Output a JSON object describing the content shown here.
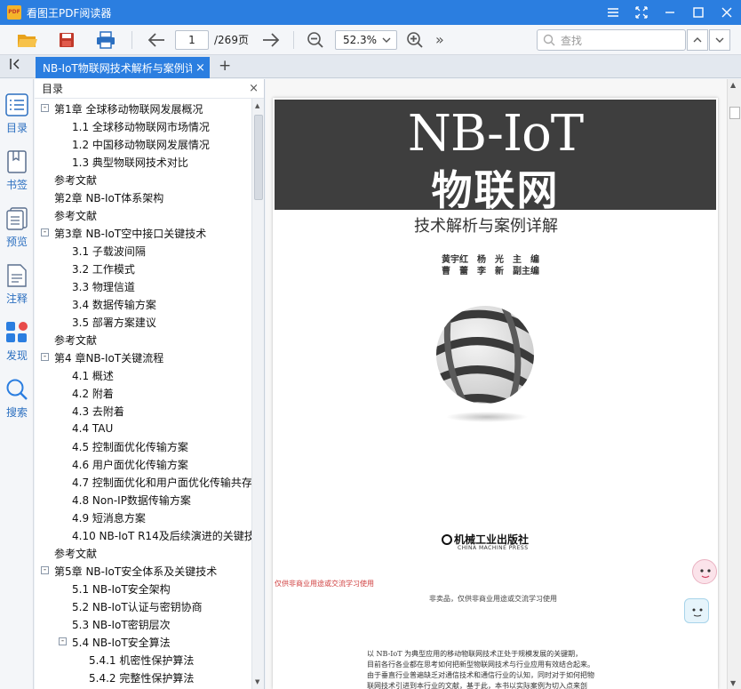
{
  "app": {
    "title": "看图王PDF阅读器",
    "logo_text": "PDF"
  },
  "toolbar": {
    "page_current": "1",
    "page_total": "/269页",
    "zoom": "52.3%",
    "search_placeholder": "查找",
    "more": "»"
  },
  "tab": {
    "label": "NB-IoT物联网技术解析与案例详解",
    "close": "×",
    "add": "+"
  },
  "leftbar": {
    "items": [
      {
        "label": "目录",
        "icon": "toc-icon"
      },
      {
        "label": "书签",
        "icon": "bookmark-icon"
      },
      {
        "label": "预览",
        "icon": "thumbnail-icon"
      },
      {
        "label": "注释",
        "icon": "annotation-icon"
      },
      {
        "label": "发现",
        "icon": "discover-icon"
      },
      {
        "label": "搜索",
        "icon": "search-icon"
      }
    ]
  },
  "toc": {
    "title": "目录",
    "close": "×",
    "items": [
      {
        "label": "第1章 全球移动物联网发展概况",
        "level": 0,
        "toggle": "-"
      },
      {
        "label": "1.1 全球移动物联网市场情况",
        "level": 1
      },
      {
        "label": "1.2 中国移动物联网发展情况",
        "level": 1
      },
      {
        "label": "1.3 典型物联网技术对比",
        "level": 1
      },
      {
        "label": "参考文献",
        "level": 0
      },
      {
        "label": "第2章 NB-IoT体系架构",
        "level": 0
      },
      {
        "label": "参考文献",
        "level": 0
      },
      {
        "label": "第3章 NB-IoT空中接口关键技术",
        "level": 0,
        "toggle": "-"
      },
      {
        "label": "3.1 子载波间隔",
        "level": 1
      },
      {
        "label": "3.2 工作模式",
        "level": 1
      },
      {
        "label": "3.3 物理信道",
        "level": 1
      },
      {
        "label": "3.4 数据传输方案",
        "level": 1
      },
      {
        "label": "3.5 部署方案建议",
        "level": 1
      },
      {
        "label": "参考文献",
        "level": 0
      },
      {
        "label": "第4 章NB-IoT关键流程",
        "level": 0,
        "toggle": "-"
      },
      {
        "label": "4.1 概述",
        "level": 1
      },
      {
        "label": "4.2 附着",
        "level": 1
      },
      {
        "label": "4.3 去附着",
        "level": 1
      },
      {
        "label": "4.4 TAU",
        "level": 1
      },
      {
        "label": "4.5 控制面优化传输方案",
        "level": 1
      },
      {
        "label": "4.6 用户面优化传输方案",
        "level": 1
      },
      {
        "label": "4.7 控制面优化和用户面优化传输共存",
        "level": 1
      },
      {
        "label": "4.8 Non-IP数据传输方案",
        "level": 1
      },
      {
        "label": "4.9 短消息方案",
        "level": 1
      },
      {
        "label": "4.10 NB-IoT R14及后续演进的关键技",
        "level": 1
      },
      {
        "label": "参考文献",
        "level": 0
      },
      {
        "label": "第5章 NB-IoT安全体系及关键技术",
        "level": 0,
        "toggle": "-"
      },
      {
        "label": "5.1 NB-IoT安全架构",
        "level": 1
      },
      {
        "label": "5.2 NB-IoT认证与密钥协商",
        "level": 1
      },
      {
        "label": "5.3 NB-IoT密钥层次",
        "level": 1
      },
      {
        "label": "5.4 NB-IoT安全算法",
        "level": 1,
        "toggle": "-"
      },
      {
        "label": "5.4.1 机密性保护算法",
        "level": 2
      },
      {
        "label": "5.4.2 完整性保护算法",
        "level": 2
      }
    ]
  },
  "page": {
    "banner_en": "NB-IoT",
    "banner_cn": "物联网",
    "subtitle": "技术解析与案例详解",
    "authors_line1": "黄宇红　杨　光　主　编",
    "authors_line2": "曹　蕾　李　新　副主编",
    "publisher": "机械工业出版社",
    "publisher_en": "CHINA MACHINE PRESS",
    "note_red": "仅供非商业用途或交流学习使用",
    "note_mid": "非卖品，仅供非商业用途或交流学习使用",
    "blurb": [
      "以 NB-IoT 为典型应用的移动物联网技术正处于规模发展的关键期，",
      "目前各行各业都在思考如何把新型物联网技术与行业应用有效结合起来。",
      "由于垂直行业普遍缺乏对通信技术和通信行业的认知，同时对于如何把物",
      "联网技术引进到本行业的文献，基于此，本书以实际案例为切入点来剖"
    ]
  },
  "colors": {
    "accent": "#2b7ee0",
    "banner": "#3e3e3e",
    "red_note": "#d04040"
  }
}
